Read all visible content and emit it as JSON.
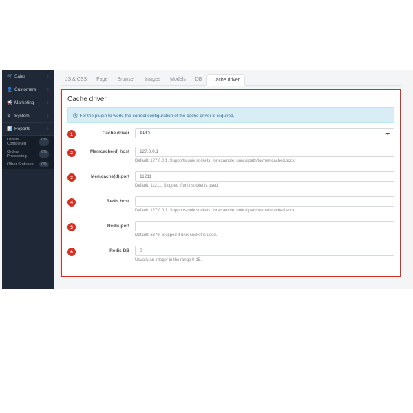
{
  "sidebar": {
    "items": [
      {
        "icon": "🛒",
        "label": "Sales"
      },
      {
        "icon": "👤",
        "label": "Customers"
      },
      {
        "icon": "📢",
        "label": "Marketing"
      },
      {
        "icon": "⚙",
        "label": "System"
      },
      {
        "icon": "📊",
        "label": "Reports"
      }
    ],
    "sub": [
      {
        "label": "Orders Completed",
        "count": "0%"
      },
      {
        "label": "Orders Processing",
        "count": "0%"
      },
      {
        "label": "Other Statuses",
        "count": "0%"
      }
    ]
  },
  "tabs": [
    "JS & CSS",
    "Page",
    "Browser",
    "Images",
    "Models",
    "DB",
    "Cache driver"
  ],
  "panel": {
    "title": "Cache driver",
    "alert": "For the plugin to work, the correct configuration of the cache driver is required."
  },
  "fields": [
    {
      "num": "1",
      "label": "Cache driver",
      "value": "APCu",
      "type": "select",
      "hint": ""
    },
    {
      "num": "2",
      "label": "Memcache(d) host",
      "value": "127.0.0.1",
      "type": "text",
      "hint": "Default: 127.0.0.1. Supports unix sockets, for example: unix:///path/to/memcached.sock."
    },
    {
      "num": "3",
      "label": "Memcache(d) port",
      "value": "11211",
      "type": "text",
      "hint": "Default: 11211. Skipped if unix socket is used."
    },
    {
      "num": "4",
      "label": "Redis host",
      "value": "",
      "type": "text",
      "hint": "Default: 127.0.0.1. Supports unix sockets, for example: unix:///path/to/memcached.sock."
    },
    {
      "num": "5",
      "label": "Redis port",
      "value": "",
      "type": "text",
      "hint": "Default: 6379. Skipped if unix socket is used."
    },
    {
      "num": "6",
      "label": "Redis DB",
      "value": "0",
      "type": "text",
      "hint": "Usually an integer in the range 0-15."
    }
  ]
}
